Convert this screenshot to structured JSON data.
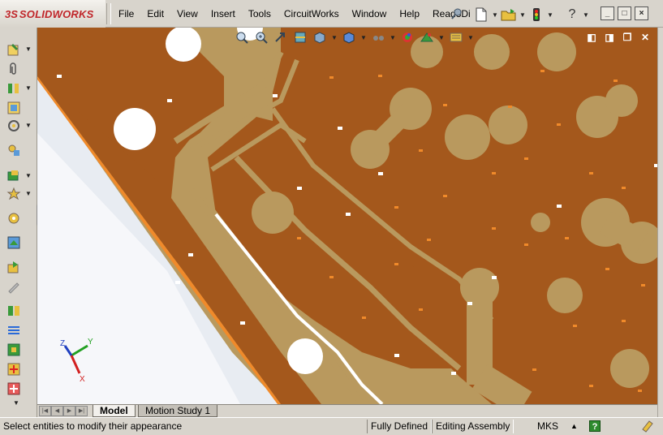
{
  "app": {
    "brand_prefix": "3S",
    "brand_name": "SOLIDWORKS"
  },
  "menu": [
    {
      "label": "File"
    },
    {
      "label": "Edit"
    },
    {
      "label": "View"
    },
    {
      "label": "Insert"
    },
    {
      "label": "Tools"
    },
    {
      "label": "CircuitWorks"
    },
    {
      "label": "Window"
    },
    {
      "label": "Help"
    },
    {
      "label": "Read3Di"
    }
  ],
  "window_controls": {
    "minimize": "_",
    "restore": "□",
    "close": "×"
  },
  "tabs": {
    "model": "Model",
    "motion_study": "Motion Study 1"
  },
  "status": {
    "message": "Select entities to modify their appearance",
    "definition": "Fully Defined",
    "mode": "Editing Assembly",
    "units": "MKS",
    "units_arrow": "▲",
    "help": "?"
  },
  "triad": {
    "x_label": "X",
    "y_label": "Y",
    "z_label": "Z"
  },
  "colors": {
    "board_copper": "#a4581c",
    "board_substrate": "#b9995e",
    "hole_fill": "#ffffff",
    "shadow": "#f08a2a",
    "triad_x": "#d22020",
    "triad_y": "#22a022",
    "triad_z": "#2040c0"
  }
}
